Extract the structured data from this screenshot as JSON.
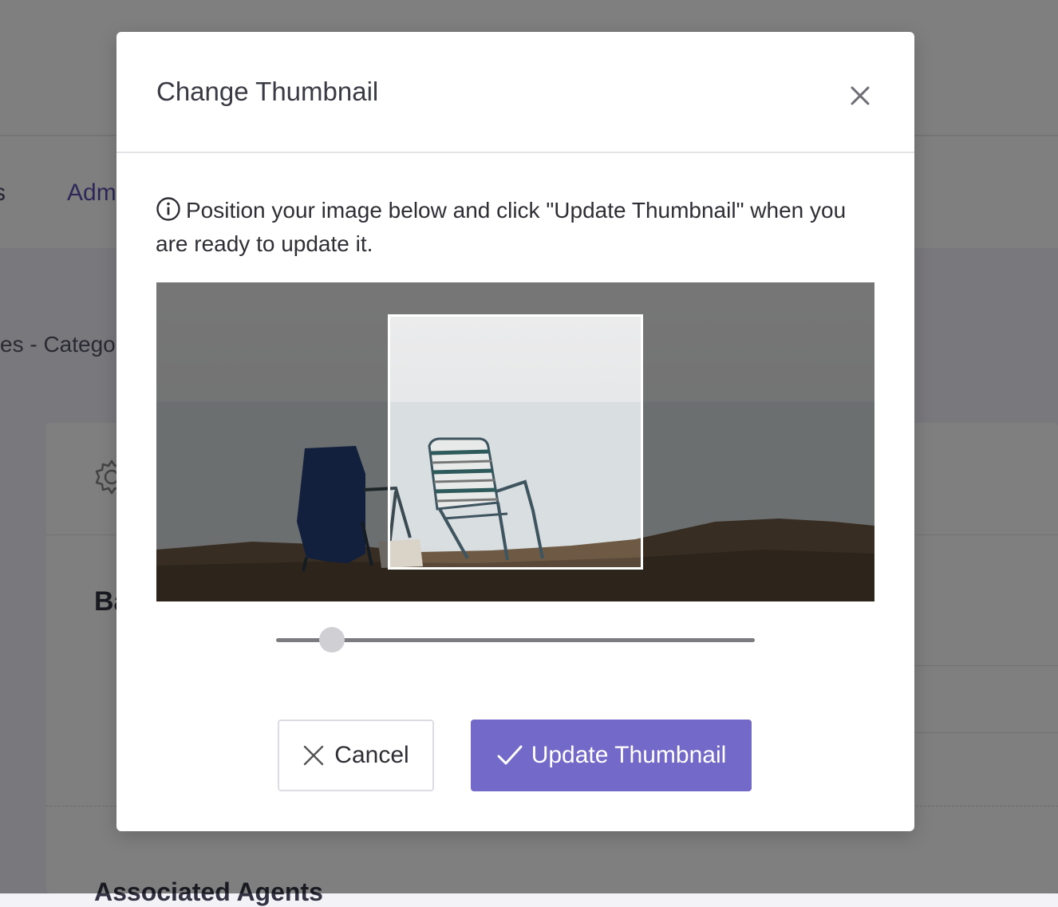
{
  "background": {
    "nav_left_partial": "s",
    "nav_admin_partial": "Adm",
    "breadcrumb_partial": "es  -  Catego",
    "card_heading_partial": "Ba",
    "card_sub_partial": "Associated Agents"
  },
  "modal": {
    "title": "Change Thumbnail",
    "info_text": "Position your image below and click \"Update Thumbnail\" when you are ready to update it.",
    "zoom_level": 0.117,
    "buttons": {
      "cancel_label": "Cancel",
      "update_label": "Update Thumbnail"
    }
  },
  "icons": {
    "close": "close-icon",
    "info": "info-icon",
    "cancel": "x-icon",
    "update": "check-icon",
    "settings": "gear-icon"
  },
  "colors": {
    "primary": "#7369c8",
    "overlay": "rgba(0,0,0,0.5)",
    "slider_track": "#7b7b80",
    "slider_thumb": "#d0d0d4"
  }
}
